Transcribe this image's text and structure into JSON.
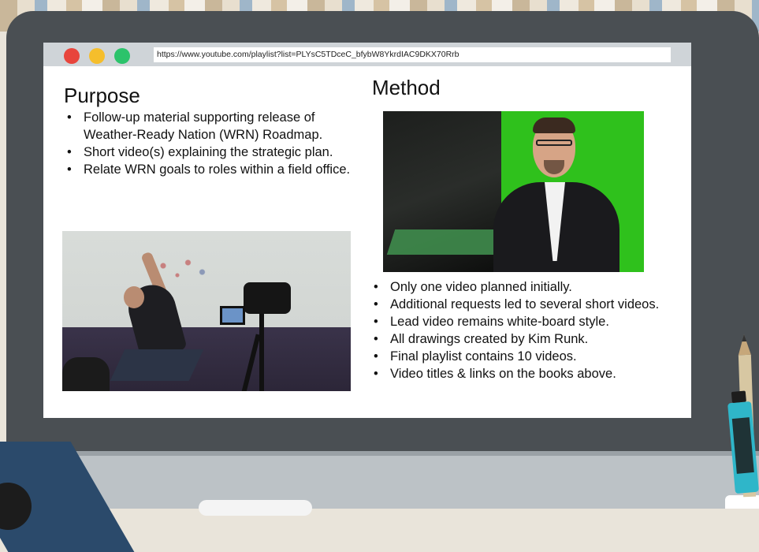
{
  "browser": {
    "url": "https://www.youtube.com/playlist?list=PLYsC5TDceC_bfybW8YkrdIAC9DKX70Rrb",
    "window_controls": [
      "close",
      "minimize",
      "maximize"
    ]
  },
  "purpose": {
    "heading": "Purpose",
    "bullets": [
      "Follow-up material supporting release of Weather-Ready Nation (WRN) Roadmap.",
      "Short video(s) explaining the strategic plan.",
      "Relate WRN goals to roles within a field office."
    ]
  },
  "method": {
    "heading": "Method",
    "bullets": [
      "Only one video planned initially.",
      "Additional requests led to several short videos.",
      "Lead video remains white-board style.",
      "All drawings created by Kim Runk.",
      "Final playlist contains 10 videos.",
      "Video titles & links on the books above."
    ]
  },
  "colors": {
    "laptop_frame": "#4a4f53",
    "close_dot": "#e8453c",
    "minimize_dot": "#f5be2c",
    "maximize_dot": "#2cc36b",
    "green_screen": "#2fc11c"
  }
}
